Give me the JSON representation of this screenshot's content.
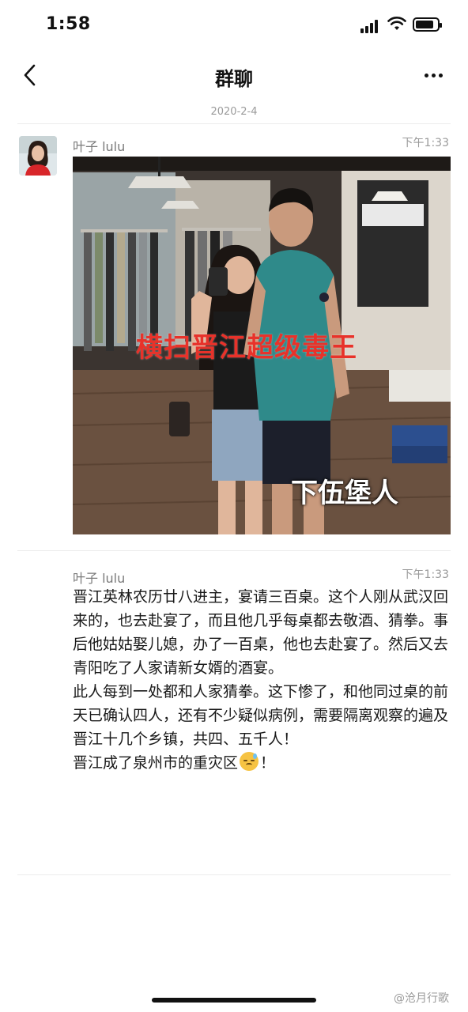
{
  "status_bar": {
    "time": "1:58"
  },
  "nav": {
    "title": "群聊"
  },
  "date_separator": "2020-2-4",
  "messages": [
    {
      "sender": "叶子 lulu",
      "time": "下午1:33",
      "image": {
        "caption_red": "横扫晋江超级毒王",
        "caption_white": "下伍堡人"
      }
    },
    {
      "sender": "叶子 lulu",
      "time": "下午1:33",
      "paragraph1": "晋江英林农历廿八进主，宴请三百桌。这个人刚从武汉回来的，也去赴宴了，而且他几乎每桌都去敬酒、猜拳。事后他姑姑娶儿媳，办了一百桌，他也去赴宴了。然后又去青阳吃了人家请新女婿的酒宴。",
      "paragraph2": "此人每到一处都和人家猜拳。这下惨了，和他同过桌的前天已确认四人，还有不少疑似病例，需要隔离观察的遍及晋江十几个乡镇，共四、五千人！",
      "paragraph3_text": "晋江成了泉州市的重灾区",
      "paragraph3_end": "！"
    }
  ],
  "watermark": "@沧月行歌",
  "icons": [
    "back-icon",
    "more-icon",
    "signal-icon",
    "wifi-icon",
    "battery-icon",
    "sweat-emoji-icon"
  ]
}
